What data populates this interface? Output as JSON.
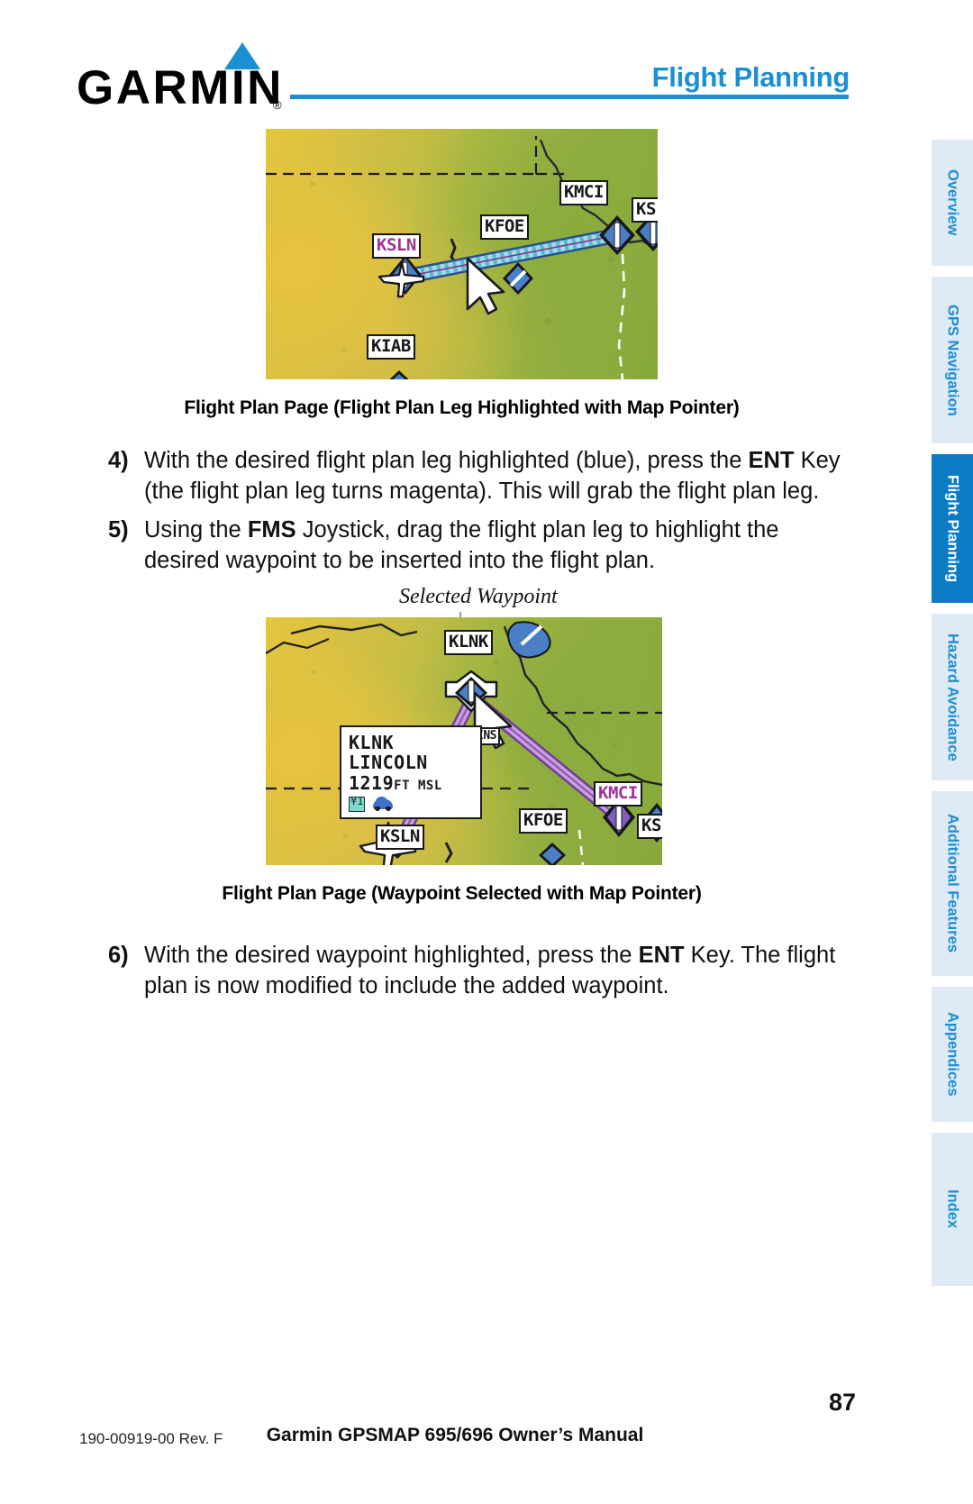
{
  "header": {
    "logo_text": "GARMIN",
    "logo_registered": "®",
    "title": "Flight Planning",
    "accent_color": "#1a8fd1"
  },
  "side_tabs": [
    {
      "label": "Overview",
      "active": false
    },
    {
      "label": "GPS Navigation",
      "active": false
    },
    {
      "label": "Flight Planning",
      "active": true
    },
    {
      "label": "Hazard Avoidance",
      "active": false
    },
    {
      "label": "Additional Features",
      "active": false
    },
    {
      "label": "Appendices",
      "active": false
    },
    {
      "label": "Index",
      "active": false
    }
  ],
  "figure1": {
    "caption": "Flight Plan Page (Flight Plan Leg Highlighted with Map Pointer)",
    "waypoint_labels": [
      {
        "text": "KMCI",
        "color": "black"
      },
      {
        "text": "KFOE",
        "color": "black"
      },
      {
        "text": "KSLN",
        "color": "magenta"
      },
      {
        "text": "KIAB",
        "color": "black"
      },
      {
        "text": "KS",
        "color": "black"
      }
    ],
    "leg_highlight_color": "#7fd4e0",
    "leg_border_color": "#2b4e8c"
  },
  "figure2": {
    "callout": "Selected Waypoint",
    "caption": "Flight Plan Page (Waypoint Selected with Map Pointer)",
    "waypoint_labels": [
      {
        "text": "KLNK",
        "color": "black"
      },
      {
        "text": "INS",
        "color": "black"
      },
      {
        "text": "KMCI",
        "color": "magenta"
      },
      {
        "text": "KFOE",
        "color": "black"
      },
      {
        "text": "KSLN",
        "color": "black"
      },
      {
        "text": "KS",
        "color": "black"
      }
    ],
    "info_box": {
      "identifier": "KLNK",
      "name": "LINCOLN",
      "elevation": "1219",
      "elevation_unit": "FT MSL",
      "services": [
        "food-icon",
        "rental-car-icon"
      ]
    },
    "route_color": "#b07fd0"
  },
  "steps": [
    {
      "number": "4)",
      "segments": [
        {
          "text": "With the desired flight plan leg highlighted (blue), press the ",
          "bold": false
        },
        {
          "text": "ENT",
          "bold": true
        },
        {
          "text": " Key (the flight plan leg turns magenta).  This will grab the flight plan leg.",
          "bold": false
        }
      ]
    },
    {
      "number": "5)",
      "segments": [
        {
          "text": "Using the ",
          "bold": false
        },
        {
          "text": "FMS",
          "bold": true
        },
        {
          "text": " Joystick, drag the flight plan leg to highlight the desired waypoint to be inserted into the flight plan.",
          "bold": false
        }
      ]
    },
    {
      "number": "6)",
      "segments": [
        {
          "text": "With the desired waypoint highlighted, press the ",
          "bold": false
        },
        {
          "text": "ENT",
          "bold": true
        },
        {
          "text": " Key.  The flight plan is now modified to include the added waypoint.",
          "bold": false
        }
      ]
    }
  ],
  "footer": {
    "part_number": "190-00919-00 Rev. F",
    "manual_title": "Garmin GPSMAP 695/696 Owner’s Manual",
    "page_number": "87"
  }
}
